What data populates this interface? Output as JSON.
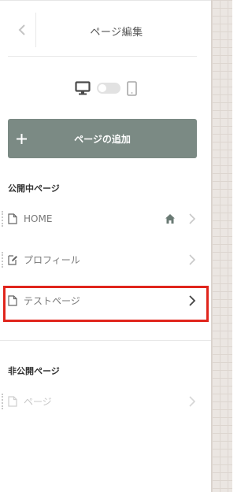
{
  "header": {
    "title": "ページ編集",
    "back_icon": "chevron-left-icon"
  },
  "device_toggle": {
    "desktop_icon": "desktop-icon",
    "mobile_icon": "smartphone-icon",
    "mode": "desktop"
  },
  "add_page_button": {
    "label": "ページの追加",
    "icon": "plus-icon",
    "color": "#7b8a84"
  },
  "published": {
    "title": "公開中ページ",
    "items": [
      {
        "label": "HOME",
        "icon": "page-icon",
        "is_home": true
      },
      {
        "label": "プロフィール",
        "icon": "edit-page-icon",
        "is_home": false
      },
      {
        "label": "テストページ",
        "icon": "page-icon",
        "is_home": false,
        "highlighted": true
      }
    ]
  },
  "unpublished": {
    "title": "非公開ページ",
    "items": [
      {
        "label": "ページ",
        "icon": "page-icon",
        "disabled": true
      }
    ]
  },
  "colors": {
    "accent": "#7b8a84",
    "highlight": "#e0251c",
    "canvas": "#ebe6e2"
  }
}
